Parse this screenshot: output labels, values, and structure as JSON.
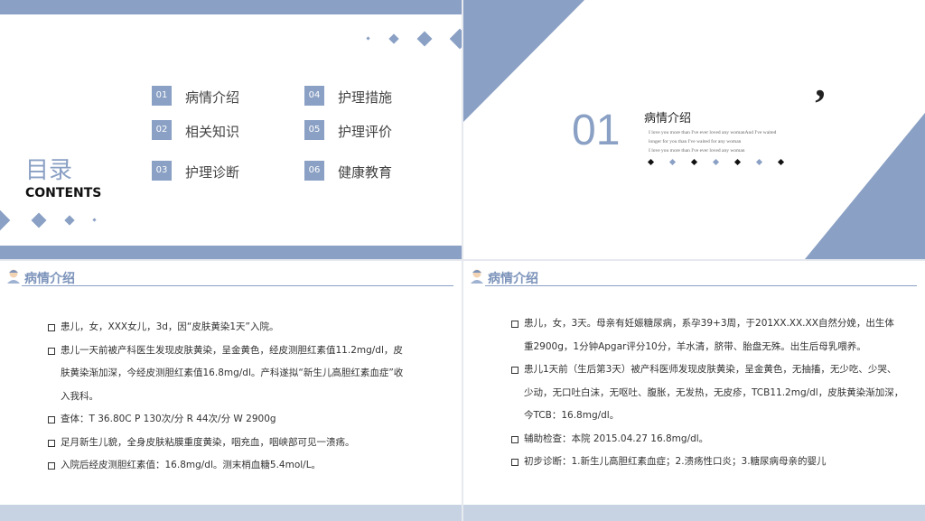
{
  "slide1": {
    "title_cn": "目录",
    "title_en": "CONTENTS",
    "items": [
      {
        "num": "01",
        "label": "病情介绍"
      },
      {
        "num": "02",
        "label": "相关知识"
      },
      {
        "num": "03",
        "label": "护理诊断"
      },
      {
        "num": "04",
        "label": "护理措施"
      },
      {
        "num": "05",
        "label": "护理评价"
      },
      {
        "num": "06",
        "label": "健康教育"
      }
    ]
  },
  "slide2": {
    "number": "01",
    "title": "病情介绍",
    "quote_mark": "’",
    "subtitle_lines": [
      "I love you more than I've ever loved any womanAnd I've waited",
      "longer for you than I've waited for any woman",
      "I love you more than I've ever loved any woman"
    ]
  },
  "slide3": {
    "header": "病情介绍",
    "bullets": [
      [
        "患儿，女，XXX女儿，3d，因“皮肤黄染1天”入院。"
      ],
      [
        "患儿一天前被产科医生发现皮肤黄染，呈金黄色，经皮测胆红素值11.2mg/dl，皮",
        "肤黄染渐加深，今经皮测胆红素值16.8mg/dl。产科遂拟“新生儿高胆红素血症”收",
        "入我科。"
      ],
      [
        "查体：T 36.80C  P 130次/分 R 44次/分 W 2900g"
      ],
      [
        "足月新生儿貌，全身皮肤粘膜重度黄染，咽充血，咽峡部可见一溃疡。"
      ],
      [
        "入院后经皮测胆红素值：16.8mg/dl。测末梢血糖5.4mol/L。"
      ]
    ]
  },
  "slide4": {
    "header": "病情介绍",
    "bullets": [
      [
        "患儿，女，3天。母亲有妊娠糖尿病，系孕39+3周，于201XX.XX.XX自然分娩，出生体",
        "重2900g，1分钟Apgar评分10分，羊水清，脐带、胎盘无殊。出生后母乳喂养。"
      ],
      [
        "患儿1天前（生后第3天）被产科医师发现皮肤黄染，呈金黄色，无抽搐，无少吃、少哭、",
        "少动，无口吐白沫，无呕吐、腹胀，无发热，无皮疹，TCB11.2mg/dl，皮肤黄染渐加深，",
        "今TCB：16.8mg/dl。"
      ],
      [
        "辅助检查：本院  2015.04.27 16.8mg/dl。"
      ],
      [
        "初步诊断：1.新生儿高胆红素血症；2.溃疡性口炎；3.糖尿病母亲的婴儿"
      ]
    ]
  },
  "colors": {
    "accent": "#8aa0c4",
    "title_blue": "#7d94bb"
  }
}
